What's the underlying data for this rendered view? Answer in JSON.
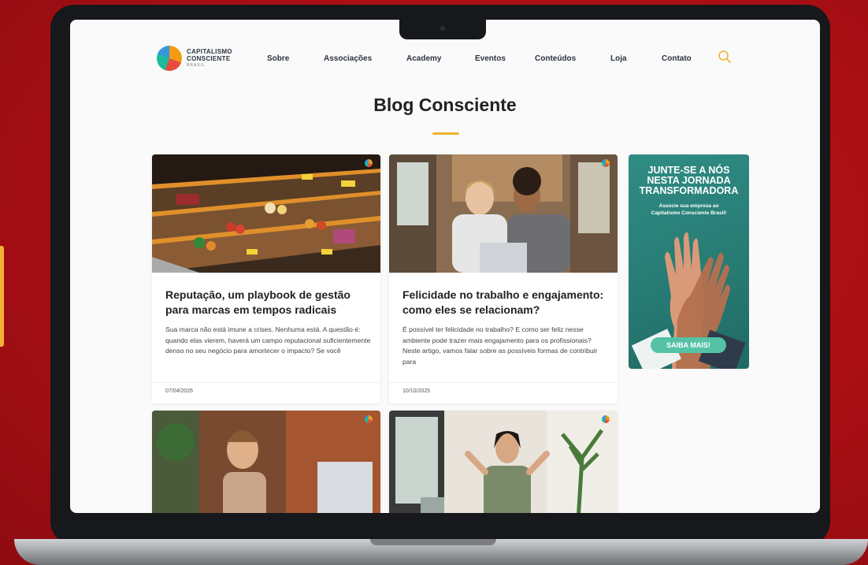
{
  "site": {
    "logo": {
      "line1": "CAPITALISMO",
      "line2": "CONSCIENTE",
      "line3": "BRASIL"
    },
    "nav": [
      "Sobre",
      "Associações",
      "Academy",
      "Eventos",
      "Conteúdos",
      "Loja",
      "Contato"
    ],
    "search_icon": "search-icon"
  },
  "page": {
    "title": "Blog Consciente"
  },
  "cards": [
    {
      "title": "Reputação, um playbook de gestão para marcas em tempos radicais",
      "excerpt": "Sua marca não está imune a crises. Nenhuma está. A questão é: quando elas vierem, haverá um campo reputacional suficientemente denso no seu negócio para amortecer o impacto? Se você",
      "date": "07/04/2026",
      "image": "supermarket-shelves"
    },
    {
      "title": "Felicidade no trabalho e engajamento: como eles se relacionam?",
      "excerpt": "É possível ter felicidade no trabalho? E como ser feliz nesse ambiente pode trazer mais engajamento para os profissionais? Neste artigo, vamos falar sobre as possíveis formas de contribuir para",
      "date": "10/10/2025",
      "image": "two-women-at-laptop"
    },
    {
      "image": "man-smiling-at-laptop"
    },
    {
      "image": "woman-stretching-at-desk"
    }
  ],
  "ad": {
    "headline": [
      "JUNTE-SE A NÓS",
      "NESTA JORNADA",
      "TRANSFORMADORA"
    ],
    "subtext": [
      "Associe sua empresa ao",
      "Capitalismo Consciente Brasil!"
    ],
    "button": "SAIBA MAIS!"
  },
  "colors": {
    "brand_red": "#b3121a",
    "accent_yellow": "#f2b233",
    "ad_teal": "#2f8d84",
    "button_mint": "#55c2a6"
  }
}
